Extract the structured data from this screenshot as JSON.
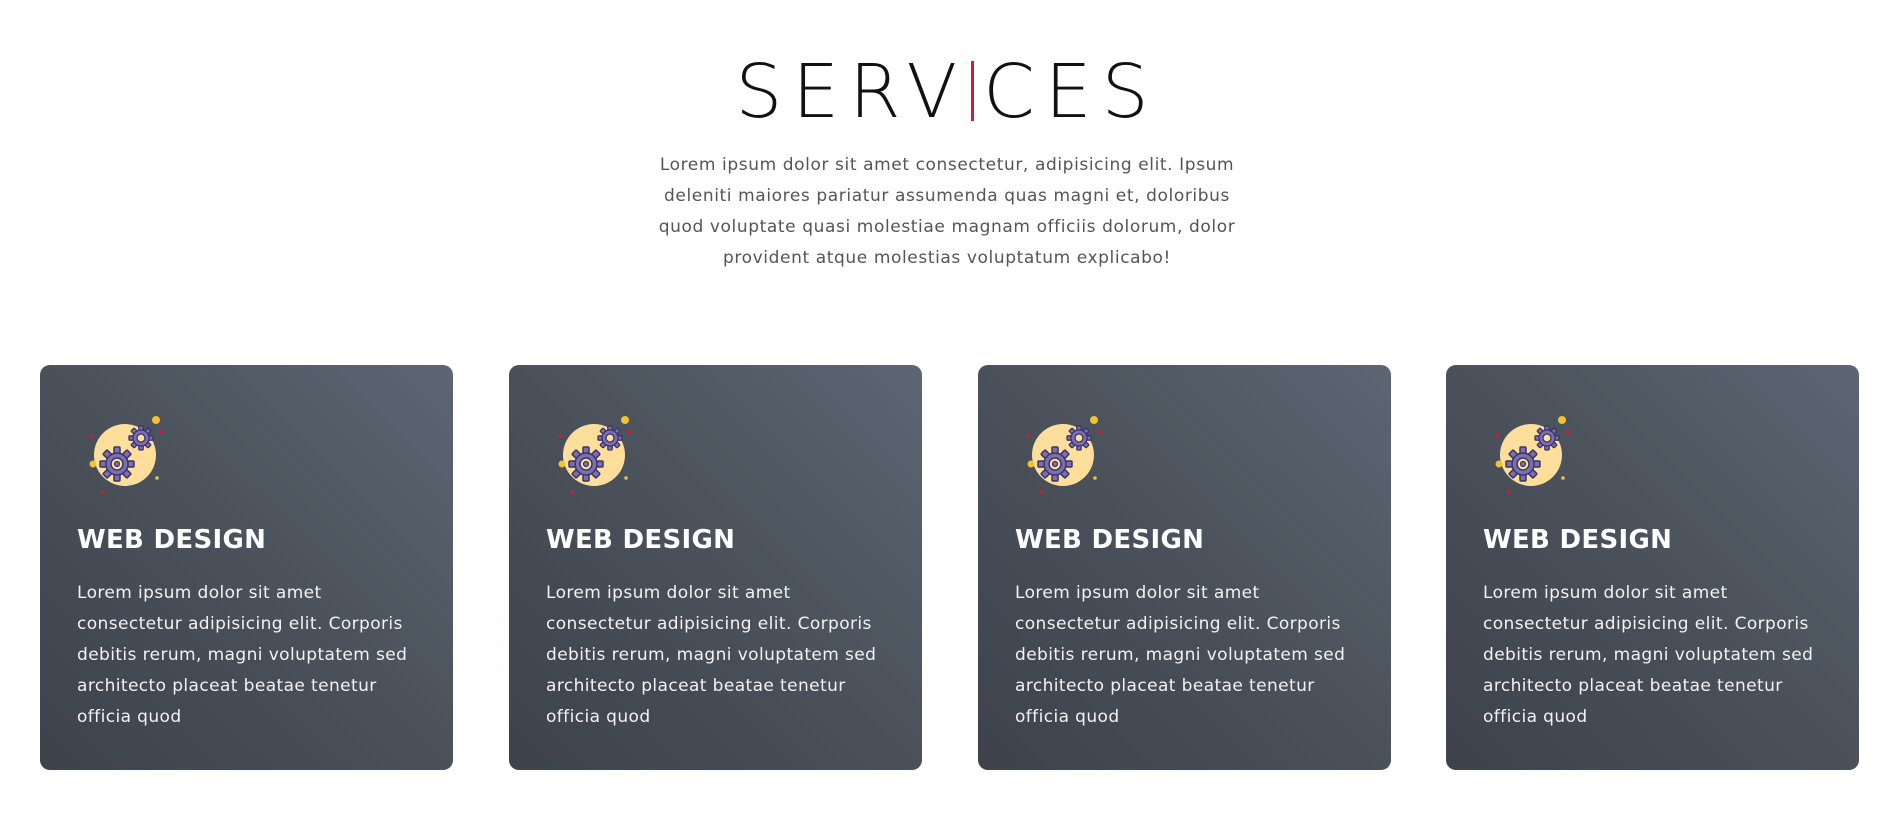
{
  "section": {
    "title_part1": "SERV",
    "title_part2": "CES",
    "intro": "Lorem ipsum dolor sit amet consectetur, adipisicing elit. Ipsum deleniti maiores pariatur assumenda quas magni et, doloribus quod voluptate quasi molestiae magnam officiis dolorum, dolor provident atque molestias voluptatum explicabo!"
  },
  "colors": {
    "accent": "#d01a3a",
    "card_bg_start": "#5c6672",
    "card_bg_end": "#3d424b",
    "icon_circle": "#fddf9b",
    "gear": "#7b6fb3"
  },
  "cards": [
    {
      "icon": "gears-icon",
      "title": "WEB DESIGN",
      "text": "Lorem ipsum dolor sit amet consectetur adipisicing elit. Corporis debitis rerum, magni voluptatem sed architecto placeat beatae tenetur officia quod"
    },
    {
      "icon": "gears-icon",
      "title": "WEB DESIGN",
      "text": "Lorem ipsum dolor sit amet consectetur adipisicing elit. Corporis debitis rerum, magni voluptatem sed architecto placeat beatae tenetur officia quod"
    },
    {
      "icon": "gears-icon",
      "title": "WEB DESIGN",
      "text": "Lorem ipsum dolor sit amet consectetur adipisicing elit. Corporis debitis rerum, magni voluptatem sed architecto placeat beatae tenetur officia quod"
    },
    {
      "icon": "gears-icon",
      "title": "WEB DESIGN",
      "text": "Lorem ipsum dolor sit amet consectetur adipisicing elit. Corporis debitis rerum, magni voluptatem sed architecto placeat beatae tenetur officia quod"
    }
  ]
}
